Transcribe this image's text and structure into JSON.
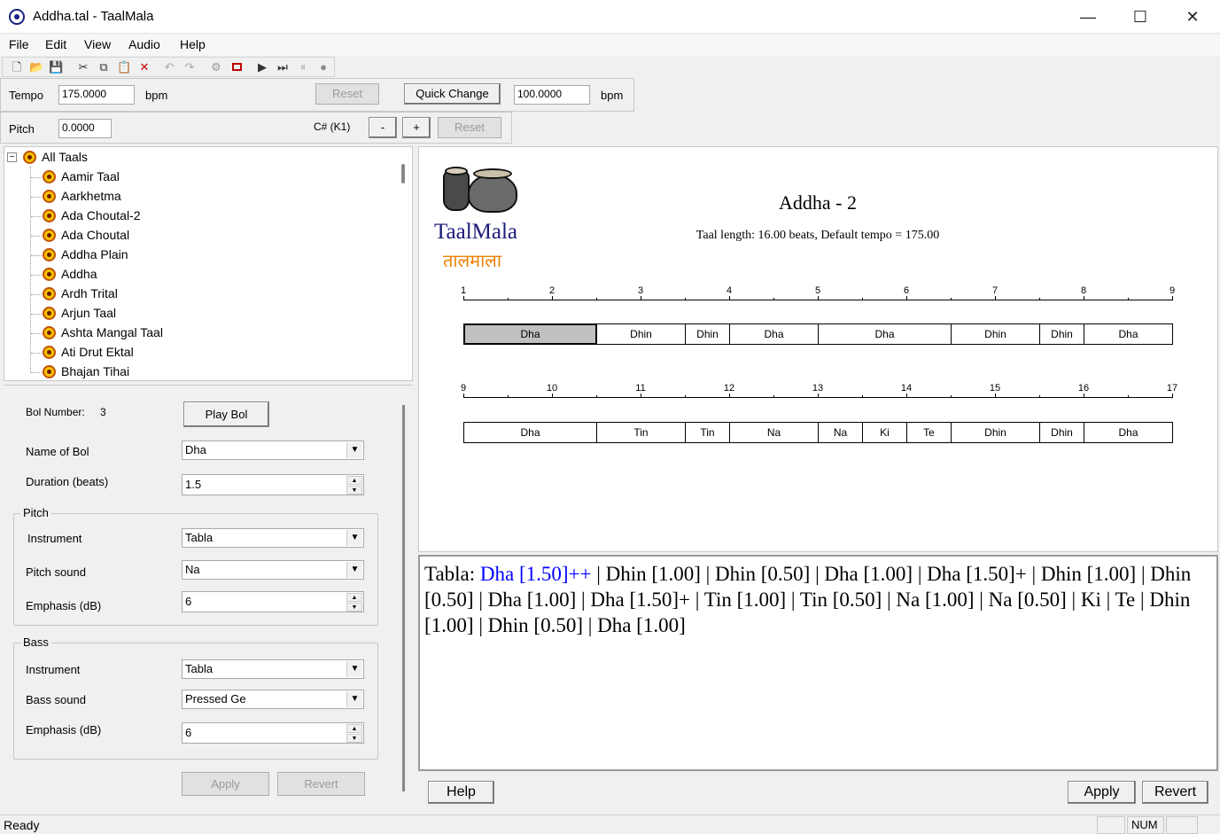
{
  "window": {
    "title": "Addha.tal - TaalMala",
    "controls": {
      "minimize": "—",
      "maximize": "☐",
      "close": "✕"
    }
  },
  "menu": [
    "File",
    "Edit",
    "View",
    "Audio",
    "Help"
  ],
  "toolbar_icons": [
    "new-icon",
    "open-icon",
    "save-icon",
    "cut-icon",
    "copy-icon",
    "paste-icon",
    "delete-icon",
    "undo-icon",
    "redo-icon",
    "properties-icon",
    "stop-icon",
    "play-icon",
    "play-step-icon",
    "pause-icon",
    "record-icon"
  ],
  "tempo": {
    "label": "Tempo",
    "value": "175.0000",
    "unit": "bpm",
    "reset_label": "Reset",
    "quick_change_label": "Quick Change",
    "quick_value": "100.0000",
    "quick_unit": "bpm"
  },
  "pitch": {
    "label": "Pitch",
    "value": "0.0000",
    "note": "C# (K1)",
    "minus_label": "-",
    "plus_label": "+",
    "reset_label": "Reset"
  },
  "tree": {
    "root": "All Taals",
    "items": [
      "Aamir Taal",
      "Aarkhetma",
      "Ada Choutal-2",
      "Ada Choutal",
      "Addha Plain",
      "Addha",
      "Ardh Trital",
      "Arjun Taal",
      "Ashta Mangal Taal",
      "Ati Drut Ektal",
      "Bhajan Tihai"
    ]
  },
  "bol_editor": {
    "bol_number_label": "Bol Number:",
    "bol_number": "3",
    "play_bol_label": "Play Bol",
    "name_label": "Name of Bol",
    "name_value": "Dha",
    "duration_label": "Duration (beats)",
    "duration_value": "1.5",
    "pitch_group": "Pitch",
    "pitch_instrument_label": "Instrument",
    "pitch_instrument_value": "Tabla",
    "pitch_sound_label": "Pitch sound",
    "pitch_sound_value": "Na",
    "pitch_emphasis_label": "Emphasis (dB)",
    "pitch_emphasis_value": "6",
    "bass_group": "Bass",
    "bass_instrument_label": "Instrument",
    "bass_instrument_value": "Tabla",
    "bass_sound_label": "Bass sound",
    "bass_sound_value": "Pressed Ge",
    "bass_emphasis_label": "Emphasis (dB)",
    "bass_emphasis_value": "6",
    "apply_label": "Apply",
    "revert_label": "Revert"
  },
  "taal_view": {
    "logo_en": "TaalMala",
    "logo_hi": "तालमाला",
    "title": "Addha - 2",
    "info": "Taal length: 16.00 beats, Default tempo = 175.00",
    "row1_beats": [
      "1",
      "2",
      "3",
      "4",
      "5",
      "6",
      "7",
      "8",
      "9"
    ],
    "row2_beats": [
      "9",
      "10",
      "11",
      "12",
      "13",
      "14",
      "15",
      "16",
      "17"
    ],
    "row1_bols": [
      {
        "name": "Dha",
        "duration": 1.5,
        "selected": true
      },
      {
        "name": "Dhin",
        "duration": 1.0
      },
      {
        "name": "Dhin",
        "duration": 0.5
      },
      {
        "name": "Dha",
        "duration": 1.0
      },
      {
        "name": "Dha",
        "duration": 1.5
      },
      {
        "name": "Dhin",
        "duration": 1.0
      },
      {
        "name": "Dhin",
        "duration": 0.5
      },
      {
        "name": "Dha",
        "duration": 1.0
      }
    ],
    "row2_bols": [
      {
        "name": "Dha",
        "duration": 1.5
      },
      {
        "name": "Tin",
        "duration": 1.0
      },
      {
        "name": "Tin",
        "duration": 0.5
      },
      {
        "name": "Na",
        "duration": 1.0
      },
      {
        "name": "Na",
        "duration": 0.5
      },
      {
        "name": "Ki",
        "duration": 0.5
      },
      {
        "name": "Te",
        "duration": 0.5
      },
      {
        "name": "Dhin",
        "duration": 1.0
      },
      {
        "name": "Dhin",
        "duration": 0.5
      },
      {
        "name": "Dha",
        "duration": 1.0
      }
    ]
  },
  "sequence": {
    "prefix": "Tabla: ",
    "highlight": "Dha [1.50]++",
    "rest": " | Dhin [1.00] | Dhin [0.50] | Dha [1.00] | Dha [1.50]+ | Dhin [1.00] | Dhin [0.50] | Dha [1.00] | Dha [1.50]+ | Tin [1.00] | Tin [0.50] | Na [1.00] | Na [0.50] | Ki | Te | Dhin [1.00] | Dhin [0.50] | Dha [1.00]",
    "highlight_color": "#0000ff"
  },
  "bottom_buttons": {
    "help": "Help",
    "apply": "Apply",
    "revert": "Revert"
  },
  "status": {
    "text": "Ready",
    "num": "NUM"
  }
}
